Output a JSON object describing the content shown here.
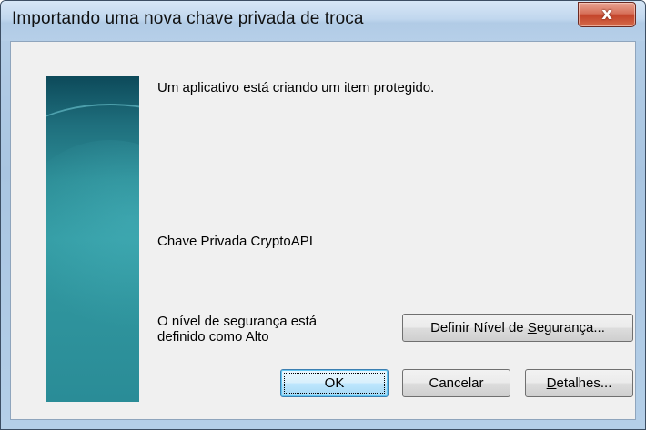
{
  "window": {
    "title": "Importando uma nova chave privada de troca",
    "close_label": "x"
  },
  "dialog": {
    "message": "Um aplicativo está criando um item protegido.",
    "item_name": "Chave Privada CryptoAPI",
    "security_line1": "O nível de segurança está",
    "security_line2": "definido como Alto"
  },
  "buttons": {
    "set_security": {
      "before": "Definir Nível de ",
      "accel": "S",
      "after": "egurança..."
    },
    "ok": "OK",
    "cancel": "Cancelar",
    "details": {
      "accel": "D",
      "after": "etalhes..."
    }
  },
  "icons": {
    "close": "close-icon"
  }
}
